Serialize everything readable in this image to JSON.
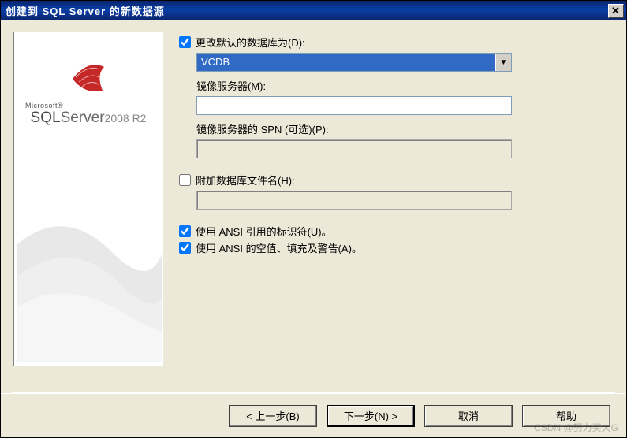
{
  "window": {
    "title": "创建到 SQL Server 的新数据源"
  },
  "sidebar": {
    "brand_small": "Microsoft®",
    "brand_sql": "SQL",
    "brand_server": "Server",
    "brand_version": "2008 R2"
  },
  "form": {
    "change_default_db": {
      "label": "更改默认的数据库为(D):",
      "checked": true,
      "value": "VCDB"
    },
    "mirror_server": {
      "label": "镜像服务器(M):",
      "value": ""
    },
    "mirror_spn": {
      "label": "镜像服务器的 SPN (可选)(P):",
      "value": ""
    },
    "attach_db_file": {
      "label": "附加数据库文件名(H):",
      "checked": false,
      "value": ""
    },
    "ansi_quoted": {
      "label": "使用 ANSI 引用的标识符(U)。",
      "checked": true
    },
    "ansi_nulls": {
      "label": "使用 ANSI 的空值、填充及警告(A)。",
      "checked": true
    }
  },
  "buttons": {
    "back": "< 上一步(B)",
    "next": "下一步(N) >",
    "cancel": "取消",
    "help": "帮助"
  },
  "watermark": "CSDN @努力买大G"
}
